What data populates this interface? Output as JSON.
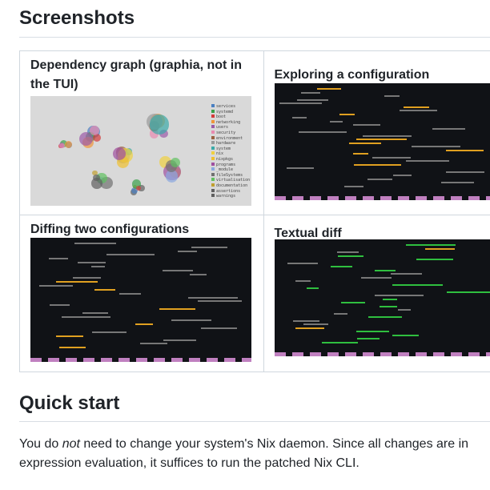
{
  "sections": [
    {
      "title": "Screenshots"
    },
    {
      "title": "Quick start"
    }
  ],
  "screenshots": [
    {
      "caption": "Dependency graph (graphia, not in the TUI)"
    },
    {
      "caption": "Exploring a configuration"
    },
    {
      "caption": "Diffing two configurations"
    },
    {
      "caption": "Textual diff"
    }
  ],
  "graph_legend": [
    {
      "label": "services",
      "color": "#4a7fc1"
    },
    {
      "label": "systemd",
      "color": "#3aa04a"
    },
    {
      "label": "boot",
      "color": "#d33a3a"
    },
    {
      "label": "networking",
      "color": "#f0963a"
    },
    {
      "label": "users",
      "color": "#9b5aa8"
    },
    {
      "label": "security",
      "color": "#e88ab0"
    },
    {
      "label": "environment",
      "color": "#9a6040"
    },
    {
      "label": "hardware",
      "color": "#9a9a9a"
    },
    {
      "label": "system",
      "color": "#3aaaa8"
    },
    {
      "label": "nix",
      "color": "#f0d040"
    },
    {
      "label": "nixpkgs",
      "color": "#f0c030"
    },
    {
      "label": "programs",
      "color": "#a050a0"
    },
    {
      "label": "_module",
      "color": "#8aa8e0"
    },
    {
      "label": "fileSystems",
      "color": "#707070"
    },
    {
      "label": "virtualisation",
      "color": "#60c060"
    },
    {
      "label": "documentation",
      "color": "#c0a030"
    },
    {
      "label": "assertions",
      "color": "#606060"
    },
    {
      "label": "warnings",
      "color": "#606060"
    }
  ],
  "quick_start": {
    "before": "You do ",
    "em": "not",
    "after": " need to change your system's Nix daemon. Since all changes are in expression evaluation, it suffices to run the patched Nix CLI."
  }
}
